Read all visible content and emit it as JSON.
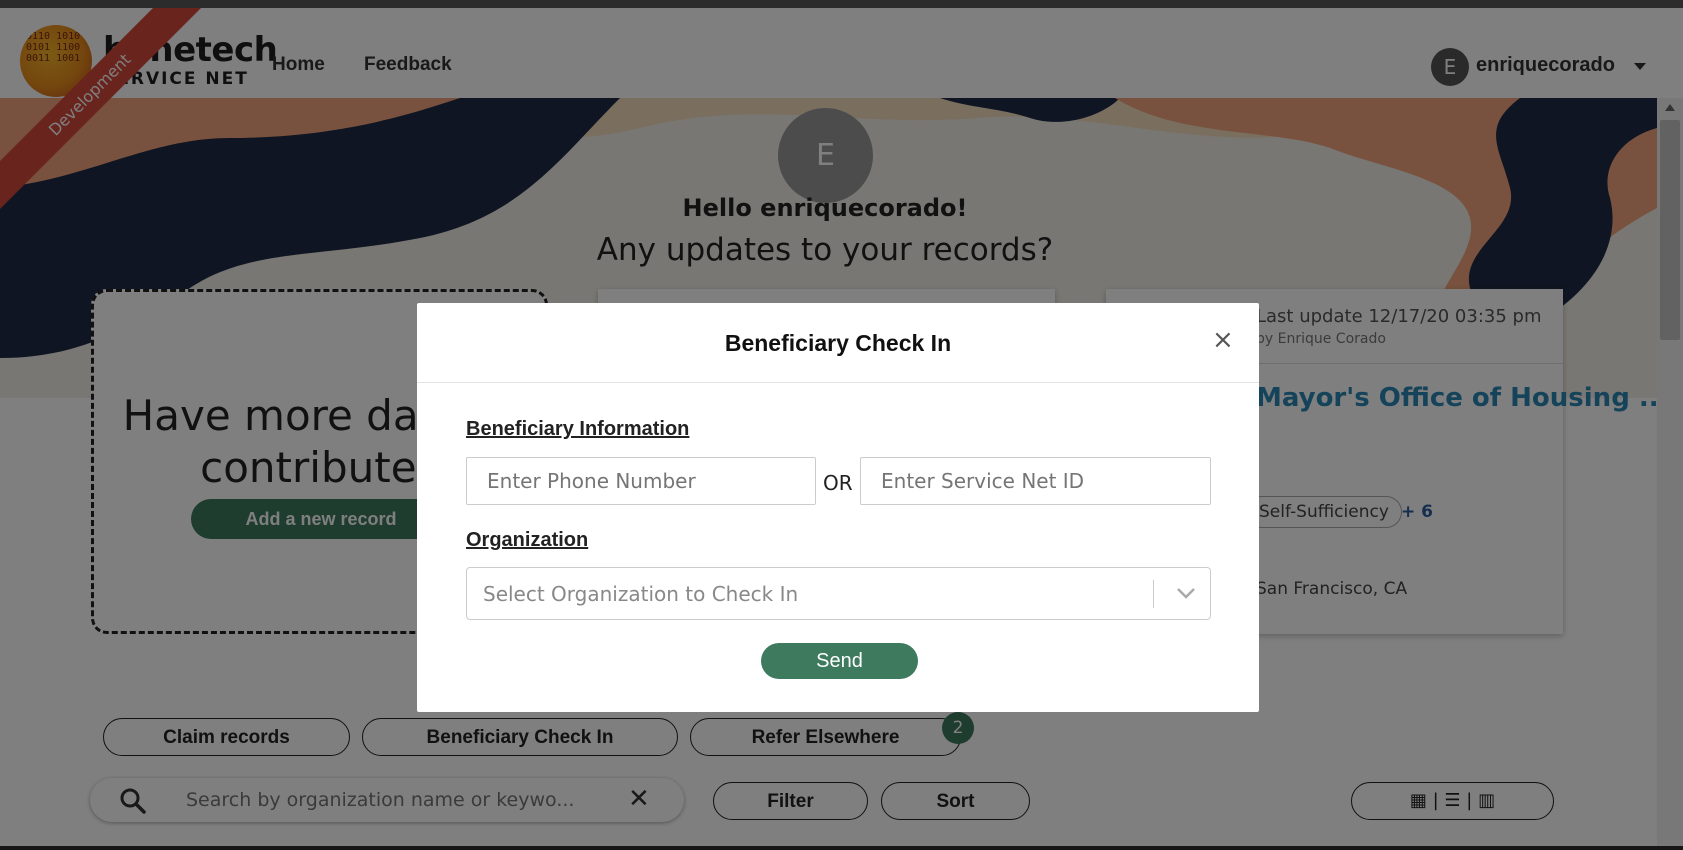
{
  "header": {
    "logo_word": "benetech",
    "logo_sub": "SERVICE NET",
    "logo_bits": "0110 1010 0101 1100 0011 1001",
    "env_ribbon": "Development",
    "nav": {
      "home": "Home",
      "feedback": "Feedback"
    },
    "user": {
      "initial": "E",
      "name": "enriquecorado"
    }
  },
  "hero": {
    "avatar_initial": "E",
    "greeting": "Hello enriquecorado!",
    "subtitle": "Any updates to your records?"
  },
  "add_card": {
    "title_line1": "Have more data to",
    "title_line2": "contribute?",
    "button": "Add a new record"
  },
  "record_card": {
    "last_update": "Last update 12/17/20 03:35 pm",
    "updated_by": "by Enrique Corado",
    "title": "Mayor's Office of Housing ...",
    "tag": "Self-Sufficiency",
    "more_tags": "+ 6",
    "location": "San Francisco, CA"
  },
  "actions": {
    "claim": "Claim records",
    "check_in": "Beneficiary Check In",
    "refer": "Refer Elsewhere",
    "refer_badge": "2"
  },
  "search": {
    "placeholder": "Search by organization name or keywo...",
    "clear": "✕"
  },
  "controls": {
    "filter": "Filter",
    "sort": "Sort",
    "view_toggle": "▦ | ☰ | ▥"
  },
  "modal": {
    "title": "Beneficiary Check In",
    "close": "×",
    "beneficiary_label": "Beneficiary Information",
    "phone_placeholder": "Enter Phone Number",
    "or": "OR",
    "id_placeholder": "Enter Service Net ID",
    "organization_label": "Organization",
    "org_placeholder": "Select Organization to Check In",
    "send": "Send"
  },
  "colors": {
    "accent_green": "#3d7a5e",
    "link_blue": "#2b86b5",
    "ribbon_red": "#d24a3b",
    "hero_navy": "#1f2a44",
    "hero_orange": "#f0a57e",
    "hero_cream": "#f5dcbf"
  }
}
